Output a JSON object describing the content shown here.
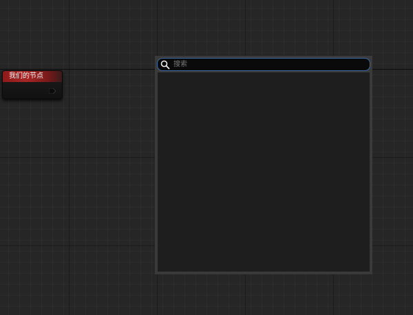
{
  "graph": {
    "node": {
      "title": "我们的节点",
      "header_color": "#a72626"
    }
  },
  "search_panel": {
    "placeholder": "搜索",
    "value": "",
    "accent_color": "#3a6aa6",
    "icon": "search-icon",
    "results": []
  }
}
